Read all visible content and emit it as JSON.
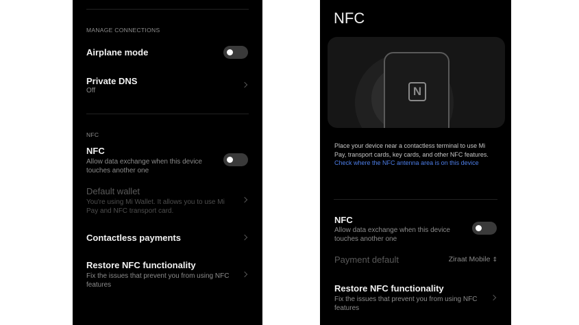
{
  "left": {
    "manage_header": "MANAGE CONNECTIONS",
    "airplane": {
      "title": "Airplane mode",
      "on": false
    },
    "dns": {
      "title": "Private DNS",
      "value": "Off"
    },
    "nfc_header": "NFC",
    "nfc": {
      "title": "NFC",
      "subtitle": "Allow data exchange when this device touches another one",
      "on": false
    },
    "wallet": {
      "title": "Default wallet",
      "subtitle": "You're using Mi Wallet. It allows you to use Mi Pay and NFC transport card."
    },
    "contactless": {
      "title": "Contactless payments"
    },
    "restore": {
      "title": "Restore NFC functionality",
      "subtitle": "Fix the issues that prevent you from using NFC features"
    }
  },
  "right": {
    "page_title": "NFC",
    "illustration_icon": "nfc-icon",
    "description": "Place your device near a contactless terminal to use Mi Pay, transport cards, key cards, and other NFC features.",
    "description_link": "Check where the NFC antenna area is on this device",
    "nfc": {
      "title": "NFC",
      "subtitle": "Allow data exchange when this device touches another one",
      "on": false
    },
    "payment": {
      "title": "Payment default",
      "value": "Ziraat Mobile"
    },
    "restore": {
      "title": "Restore NFC functionality",
      "subtitle": "Fix the issues that prevent you from using NFC features"
    }
  },
  "colors": {
    "background": "#000000",
    "link": "#4d7ee8",
    "toggle_off": "#3a3a3a"
  }
}
